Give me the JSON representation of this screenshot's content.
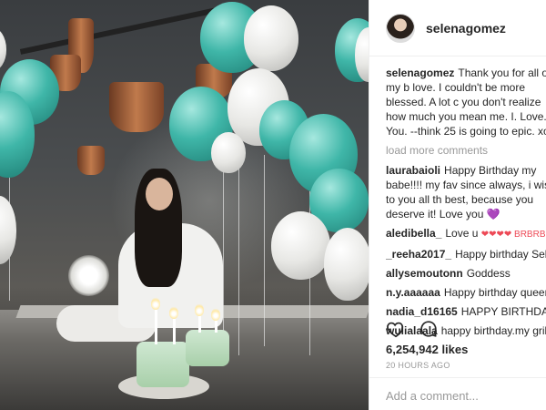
{
  "post": {
    "username": "selenagomez",
    "caption": "Thank you for all of my b love. I couldn't be more blessed. A lot c you don't realize how much you mean me. I. Love. You. --think 25 is going to epic. xo",
    "load_more": "load more comments",
    "comments": [
      {
        "user": "laurabaioli",
        "text": "Happy Birthday my babe!!!! my fav since always, i wish to you all th best, because you deserve it! Love you",
        "emoji": "💜"
      },
      {
        "user": "aledibella_",
        "text": "Love u",
        "emoji": "❤❤❤❤ BRBRBR"
      },
      {
        "user": "_reeha2017_",
        "text": "Happy birthday Selena",
        "emoji": "🎉🎉🎉"
      },
      {
        "user": "allysemoutonn",
        "text": "Goddess",
        "emoji": ""
      },
      {
        "user": "n.y.aaaaaa",
        "text": "Happy birthday queen",
        "emoji": "❤"
      },
      {
        "user": "nadia_d16165",
        "text": "HAPPY BIRTHDAY",
        "emoji": "🎉📦"
      },
      {
        "user": "wulialaala",
        "text": "happy birthday.my gril",
        "emoji": ""
      }
    ],
    "likes": "6,254,942 likes",
    "time": "20 HOURS AGO",
    "add_comment_placeholder": "Add a comment..."
  },
  "icons": {
    "like": "heart-outline-icon",
    "comment": "speech-bubble-icon"
  }
}
